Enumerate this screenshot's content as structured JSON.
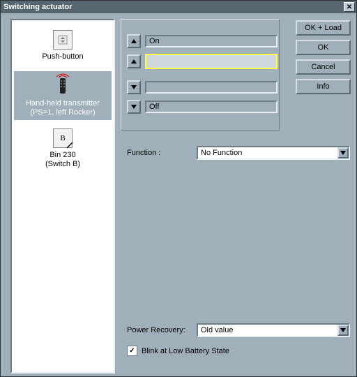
{
  "window": {
    "title": "Switching actuator"
  },
  "buttons": {
    "ok_load": "OK + Load",
    "ok": "OK",
    "cancel": "Cancel",
    "info": "Info"
  },
  "sidebar": {
    "items": [
      {
        "label_line1": "Push-button",
        "label_line2": ""
      },
      {
        "label_line1": "Hand-held transmitter",
        "label_line2": "(PS=1, left Rocker)"
      },
      {
        "label_line1": "Bin 230",
        "label_line2": "(Switch B)"
      }
    ]
  },
  "rows": {
    "r0": "On",
    "r1": "",
    "r2": "",
    "r3": "Off"
  },
  "function": {
    "label": "Function :",
    "value": "No Function"
  },
  "power": {
    "label": "Power Recovery:",
    "value": "Old value"
  },
  "checkbox": {
    "label": "Blink at Low Battery State",
    "checked": true
  }
}
